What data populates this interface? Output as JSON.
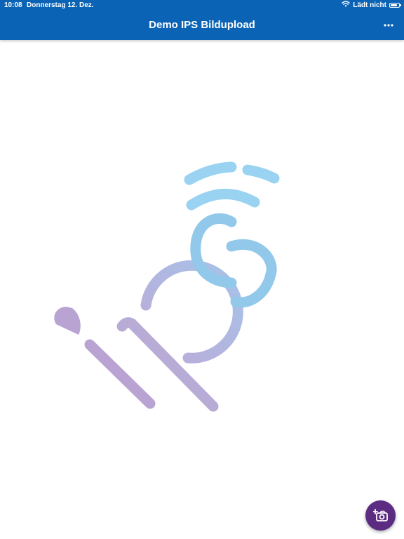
{
  "status_bar": {
    "time": "10:08",
    "date": "Donnerstag 12. Dez.",
    "charging": "Lädt nicht",
    "wifi_icon": "wifi-icon",
    "battery_icon": "battery-icon"
  },
  "navbar": {
    "title": "Demo IPS Bildupload",
    "more_icon": "more-horizontal-icon"
  },
  "logo": {
    "icon": "ips-logo"
  },
  "fab": {
    "icon": "add-photo-camera-icon"
  },
  "colors": {
    "primary": "#0b63b5",
    "fab": "#5c2c82",
    "logo_purple": "#b6a4d6",
    "logo_blue": "#8fcdf0"
  }
}
